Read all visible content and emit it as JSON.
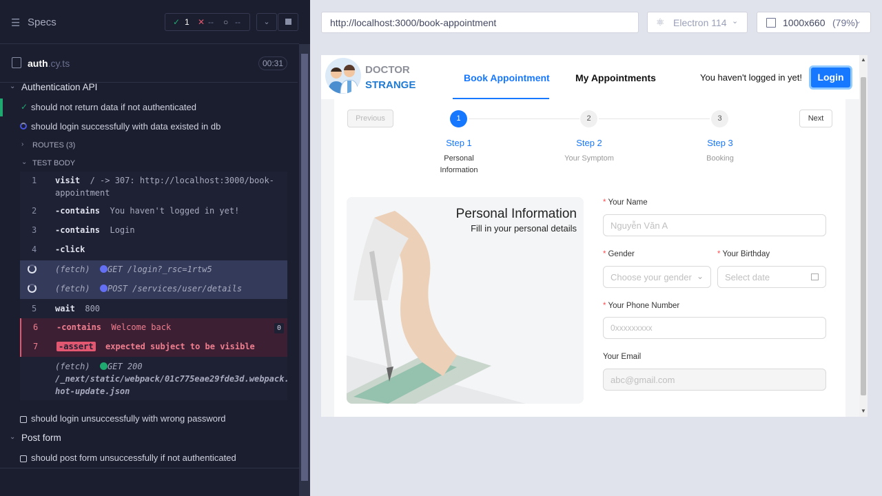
{
  "specs": {
    "title": "Specs",
    "stats": {
      "passed": "1",
      "failed": "--",
      "pending": "--"
    }
  },
  "spec_file": {
    "name": "auth",
    "ext": ".cy.ts",
    "duration": "00:31"
  },
  "suites": [
    {
      "title": "Authentication API",
      "tests": [
        {
          "title": "should not return data if not authenticated",
          "state": "passed"
        },
        {
          "title": "should login successfully with data existed in db",
          "state": "running"
        }
      ]
    },
    {
      "title": "Post form",
      "tests": [
        {
          "title": "should post form unsuccessfully if not authenticated",
          "state": "pending"
        }
      ]
    }
  ],
  "routes_label": "ROUTES (3)",
  "test_body_label": "TEST BODY",
  "commands": [
    {
      "num": "1",
      "name": "visit",
      "msg": "/ -> 307: http://localhost:3000/book-",
      "msg2": "appointment"
    },
    {
      "num": "2",
      "name": "-contains",
      "msg": "You haven't logged in yet!"
    },
    {
      "num": "3",
      "name": "-contains",
      "msg": "Login"
    },
    {
      "num": "4",
      "name": "-click",
      "msg": ""
    },
    {
      "num": "",
      "name": "(fetch)",
      "msg": "GET /login?_rsc=1rtw5"
    },
    {
      "num": "",
      "name": "(fetch)",
      "msg": "POST /services/user/details"
    },
    {
      "num": "5",
      "name": "wait",
      "msg": "800"
    },
    {
      "num": "6",
      "name": "-contains",
      "msg": "Welcome back",
      "badge": "0"
    },
    {
      "num": "7",
      "name": "-assert",
      "msg": "expected subject to be visible"
    },
    {
      "num": "",
      "name": "(fetch)",
      "msg": "GET 200",
      "msg2": "/_next/static/webpack/01c775eae29fde3d.webpack.",
      "msg3": "hot-update.json"
    }
  ],
  "extra_test": "should login unsuccessfully with wrong password",
  "browser": {
    "url": "http://localhost:3000/book-appointment",
    "engine": "Electron 114",
    "viewport": "1000x660",
    "zoom": "(79%)"
  },
  "app": {
    "logo_line1": "DOCTOR",
    "logo_line2": "STRANGE",
    "nav_book": "Book Appointment",
    "nav_my": "My Appointments",
    "not_logged": "You haven't logged in yet!",
    "login": "Login",
    "prev": "Previous",
    "next": "Next",
    "steps": [
      {
        "n": "1",
        "title": "Step 1",
        "desc1": "Personal",
        "desc2": "Information"
      },
      {
        "n": "2",
        "title": "Step 2",
        "desc1": "Your Symptom",
        "desc2": ""
      },
      {
        "n": "3",
        "title": "Step 3",
        "desc1": "Booking",
        "desc2": ""
      }
    ],
    "hero_title": "Personal Information",
    "hero_sub": "Fill in your personal details",
    "form": {
      "name_label": "Your Name",
      "name_ph": "Nguyễn Văn A",
      "gender_label": "Gender",
      "gender_ph": "Choose your gender",
      "birthday_label": "Your Birthday",
      "birthday_ph": "Select date",
      "phone_label": "Your Phone Number",
      "phone_ph": "0xxxxxxxxx",
      "email_label": "Your Email",
      "email_ph": "abc@gmail.com"
    }
  }
}
